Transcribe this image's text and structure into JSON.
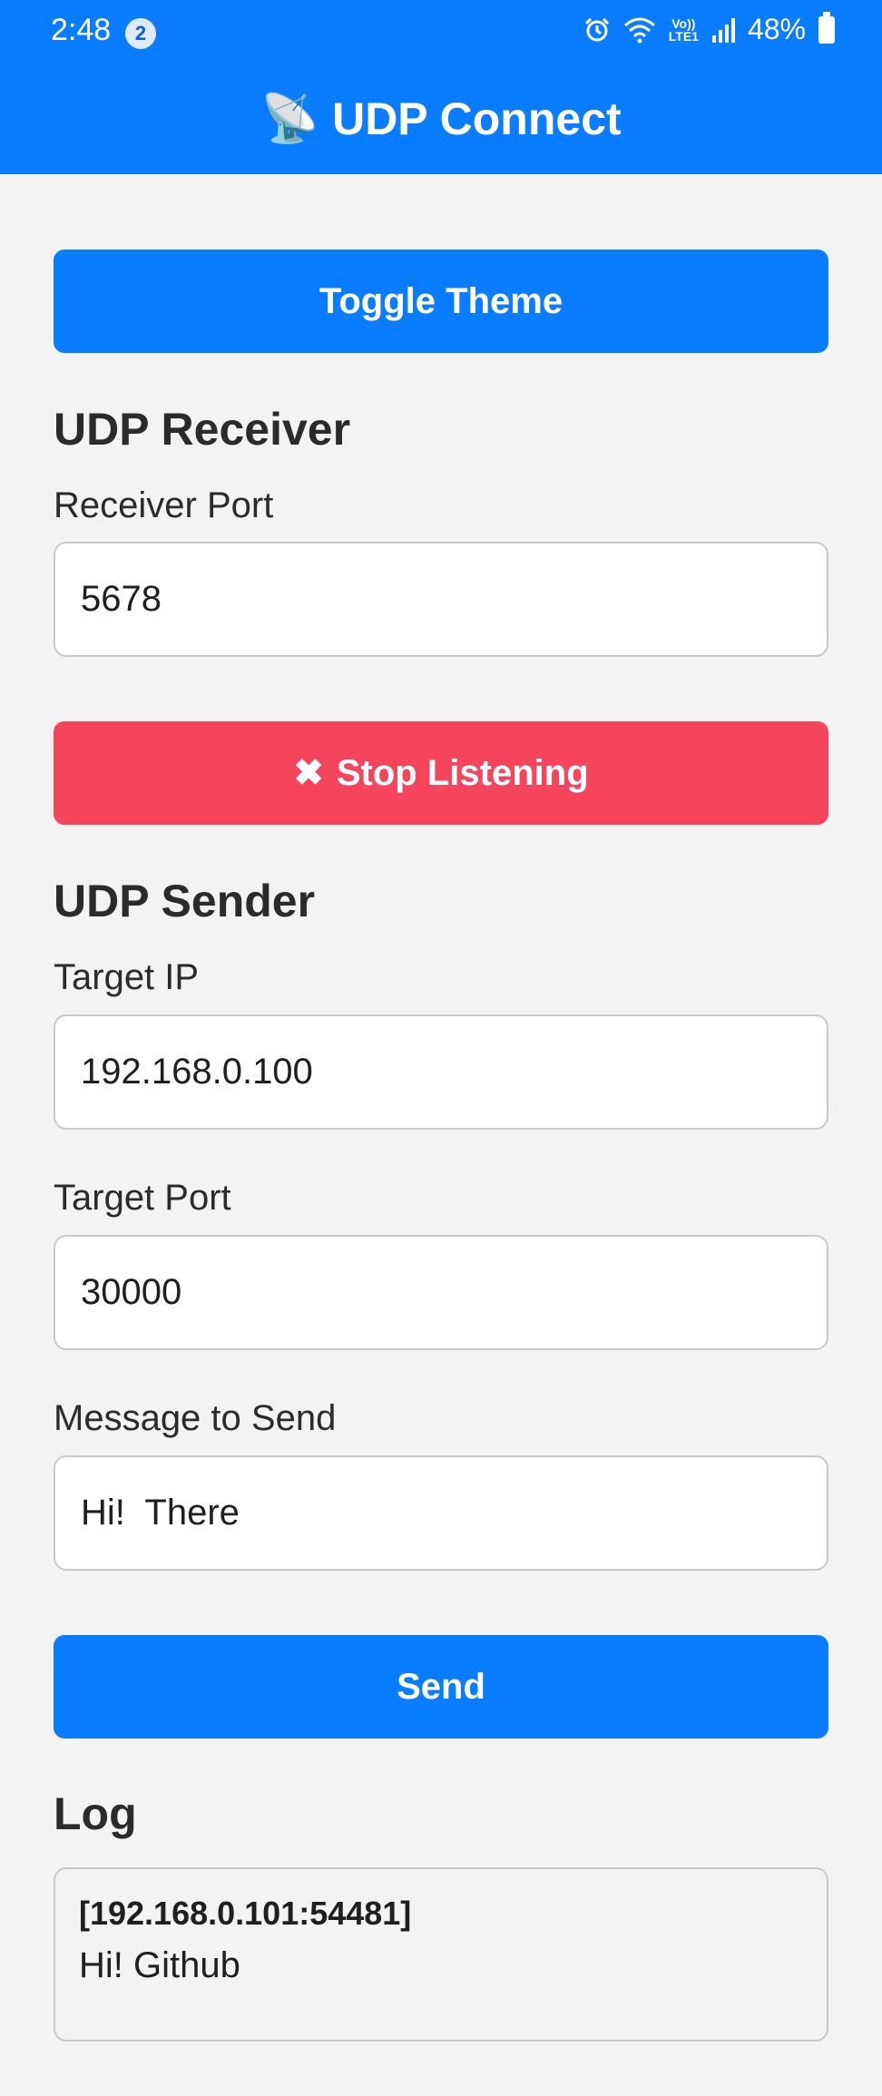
{
  "status_bar": {
    "time": "2:48",
    "notification_count": "2",
    "volte_top": "Vo))",
    "volte_bottom": "LTE1",
    "battery": "48%"
  },
  "header": {
    "icon": "satellite-antenna",
    "title": "UDP Connect",
    "color": "#0a7cff"
  },
  "toggle_theme_label": "Toggle Theme",
  "receiver": {
    "heading": "UDP Receiver",
    "port_label": "Receiver Port",
    "port_value": "5678",
    "stop_label": "Stop Listening",
    "stop_color": "#f5455c"
  },
  "sender": {
    "heading": "UDP Sender",
    "ip_label": "Target IP",
    "ip_value": "192.168.0.100",
    "port_label": "Target Port",
    "port_value": "30000",
    "message_label": "Message to Send",
    "message_value": "Hi!  There",
    "send_label": "Send"
  },
  "log": {
    "heading": "Log",
    "entries": [
      {
        "source": "[192.168.0.101:54481]",
        "message": "Hi! Github"
      }
    ]
  }
}
